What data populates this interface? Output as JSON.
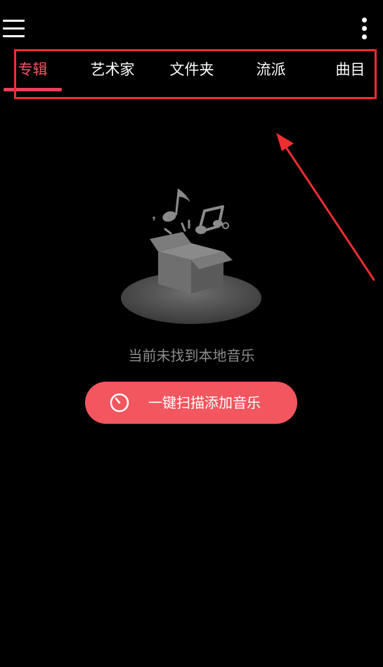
{
  "header": {
    "menu_icon": "hamburger-menu-icon",
    "more_icon": "more-vertical-icon"
  },
  "tabs": [
    {
      "label": "专辑",
      "active": true
    },
    {
      "label": "艺术家",
      "active": false
    },
    {
      "label": "文件夹",
      "active": false
    },
    {
      "label": "流派",
      "active": false
    },
    {
      "label": "曲目",
      "active": false
    }
  ],
  "empty_state": {
    "illustration_icon": "music-box-icon",
    "message": "当前未找到本地音乐"
  },
  "scan_button": {
    "icon": "scan-timer-icon",
    "label": "一键扫描添加音乐"
  },
  "colors": {
    "background": "#000000",
    "accent": "#f2565f",
    "active_tab": "#f25662",
    "annotation": "#ee2e31",
    "muted_text": "#8c8c8c"
  }
}
